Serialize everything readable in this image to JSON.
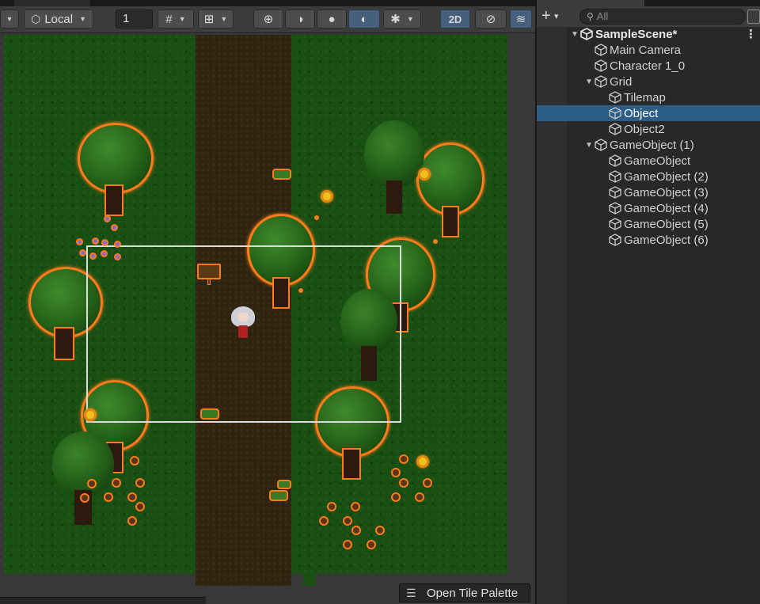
{
  "scene_toolbar": {
    "pivot_label": "Local",
    "grid_snap_value": "1",
    "mode_2d_label": "2D",
    "icons": [
      "dropdown-icon",
      "pivot-icon",
      "grid-snap-icon",
      "increment-snap-icon",
      "draw-mode-icon",
      "shading-wireframe-icon",
      "shading-shaded-icon",
      "shading-lit-icon",
      "gizmos-icon",
      "audio-mute-icon",
      "layers-icon"
    ]
  },
  "scene_view": {
    "open_tile_palette_label": "Open Tile Palette"
  },
  "hierarchy": {
    "search_placeholder": "All",
    "scene_name": "SampleScene*",
    "items": [
      {
        "label": "Main Camera",
        "depth": 1,
        "expandable": false,
        "selected": false
      },
      {
        "label": "Character 1_0",
        "depth": 1,
        "expandable": false,
        "selected": false
      },
      {
        "label": "Grid",
        "depth": 1,
        "expandable": true,
        "selected": false
      },
      {
        "label": "Tilemap",
        "depth": 2,
        "expandable": false,
        "selected": false
      },
      {
        "label": "Object",
        "depth": 2,
        "expandable": false,
        "selected": true
      },
      {
        "label": "Object2",
        "depth": 2,
        "expandable": false,
        "selected": false
      },
      {
        "label": "GameObject (1)",
        "depth": 1,
        "expandable": true,
        "selected": false
      },
      {
        "label": "GameObject",
        "depth": 2,
        "expandable": false,
        "selected": false
      },
      {
        "label": "GameObject (2)",
        "depth": 2,
        "expandable": false,
        "selected": false
      },
      {
        "label": "GameObject (3)",
        "depth": 2,
        "expandable": false,
        "selected": false
      },
      {
        "label": "GameObject (4)",
        "depth": 2,
        "expandable": false,
        "selected": false
      },
      {
        "label": "GameObject (5)",
        "depth": 2,
        "expandable": false,
        "selected": false
      },
      {
        "label": "GameObject (6)",
        "depth": 2,
        "expandable": false,
        "selected": false
      }
    ]
  },
  "colors": {
    "selection_outline": "#ff7a1a",
    "selected_row": "#2c5d87",
    "grass": "#1a4f14",
    "dirt_path": "#2e2410",
    "active_toggle": "#46607c"
  }
}
